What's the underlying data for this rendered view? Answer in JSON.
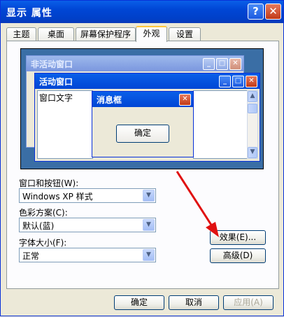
{
  "window": {
    "title": "显示 属性",
    "help_glyph": "?",
    "close_glyph": "✕"
  },
  "tabs": [
    {
      "label": "主题"
    },
    {
      "label": "桌面"
    },
    {
      "label": "屏幕保护程序"
    },
    {
      "label": "外观",
      "active": true
    },
    {
      "label": "设置"
    }
  ],
  "preview": {
    "inactive_title": "非活动窗口",
    "active_title": "活动窗口",
    "window_text": "窗口文字",
    "msgbox_title": "消息框",
    "msgbox_ok": "确定",
    "min_glyph": "_",
    "max_glyph": "□",
    "close_glyph": "✕",
    "scroll_up": "▲",
    "scroll_down": "▼"
  },
  "fields": {
    "windows_buttons_label": "窗口和按钮(W):",
    "windows_buttons_value": "Windows XP 样式",
    "color_scheme_label": "色彩方案(C):",
    "color_scheme_value": "默认(蓝)",
    "font_size_label": "字体大小(F):",
    "font_size_value": "正常",
    "dropdown_glyph": "▼"
  },
  "buttons": {
    "effects": "效果(E)...",
    "advanced": "高级(D)",
    "ok": "确定",
    "cancel": "取消",
    "apply": "应用(A)"
  },
  "colors": {
    "title_blue": "#0046d5",
    "desktop_blue": "#3a6ea5",
    "annotation_red": "#e01010"
  }
}
